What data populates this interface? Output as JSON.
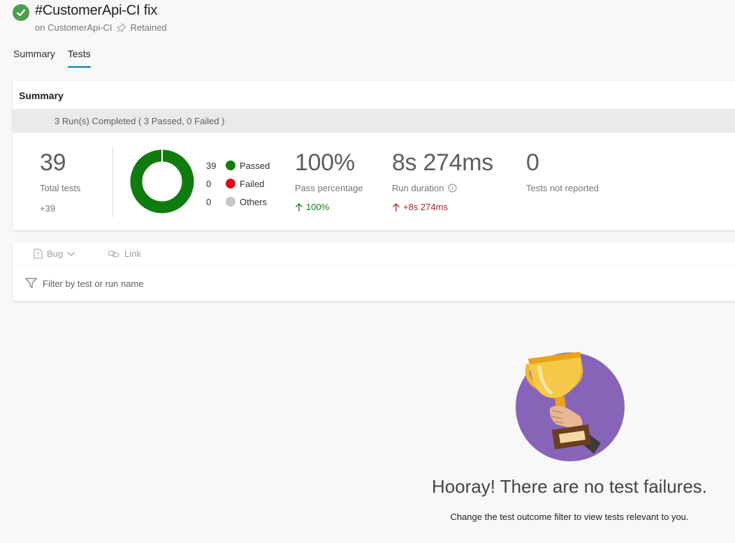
{
  "header": {
    "title": "#CustomerApi-CI fix",
    "subtitle_prefix": "on CustomerApi-CI",
    "retained_label": "Retained"
  },
  "tabs": [
    {
      "label": "Summary",
      "active": false
    },
    {
      "label": "Tests",
      "active": true
    }
  ],
  "summary": {
    "card_title": "Summary",
    "runs_text": "3 Run(s) Completed ( 3 Passed, 0 Failed )",
    "total_tests": {
      "value": "39",
      "label": "Total tests",
      "delta": "+39"
    },
    "outcomes": [
      {
        "count": "39",
        "label": "Passed",
        "color": "#107c10"
      },
      {
        "count": "0",
        "label": "Failed",
        "color": "#e00b1c"
      },
      {
        "count": "0",
        "label": "Others",
        "color": "#c8c6c4"
      }
    ],
    "pass_percentage": {
      "value": "100%",
      "label": "Pass percentage",
      "delta": "100%"
    },
    "run_duration": {
      "value": "8s 274ms",
      "label": "Run duration",
      "delta": "+8s 274ms"
    },
    "not_reported": {
      "value": "0",
      "label": "Tests not reported"
    }
  },
  "toolbar": {
    "bug_label": "Bug",
    "link_label": "Link",
    "filter_placeholder": "Filter by test or run name"
  },
  "empty_state": {
    "heading": "Hooray! There are no test failures.",
    "subtext": "Change the test outcome filter to view tests relevant to you."
  },
  "colors": {
    "success": "#4d9e4d",
    "tab_underline": "#0078d4",
    "passed": "#107c10",
    "trophy_circle": "#8764b8"
  }
}
